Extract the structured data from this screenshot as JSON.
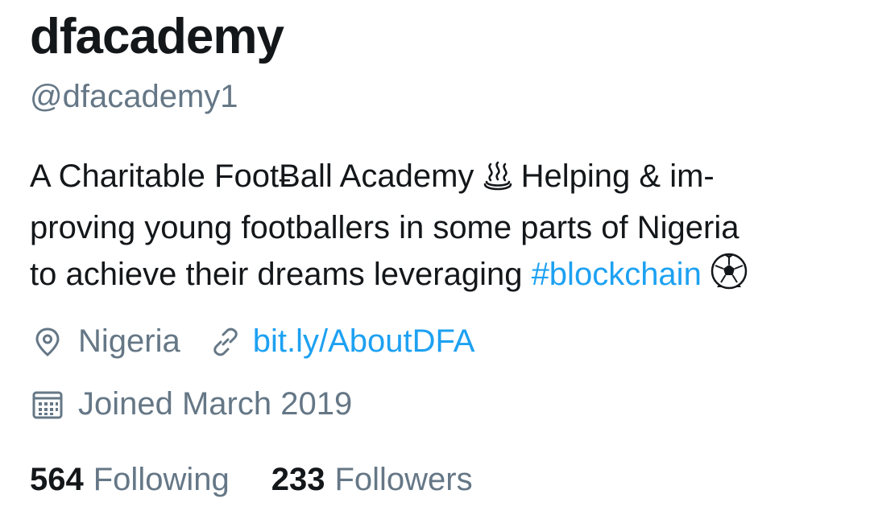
{
  "profile": {
    "display_name": "dfacademy",
    "handle": "@dfacademy1",
    "bio": {
      "line1_part1": "A Charitable FootɃall Academy ",
      "line1_part2": " Helping & im-",
      "line2": "proving young footballers in some parts of Nigeria",
      "line3_part1": "to achieve their dreams leveraging ",
      "hashtag": "#blockchain",
      "line3_part2": " "
    },
    "location": "Nigeria",
    "website": "bit.ly/AboutDFA",
    "joined": "Joined March 2019",
    "following_count": "564",
    "following_label": "Following",
    "followers_count": "233",
    "followers_label": "Followers"
  },
  "icons": {
    "hot_springs": "hot-springs-icon",
    "soccer_ball": "soccer-ball-icon",
    "location": "location-pin-icon",
    "link": "link-icon",
    "calendar": "calendar-icon"
  },
  "colors": {
    "text_primary": "#14171a",
    "text_secondary": "#657786",
    "link": "#1da1f2"
  }
}
